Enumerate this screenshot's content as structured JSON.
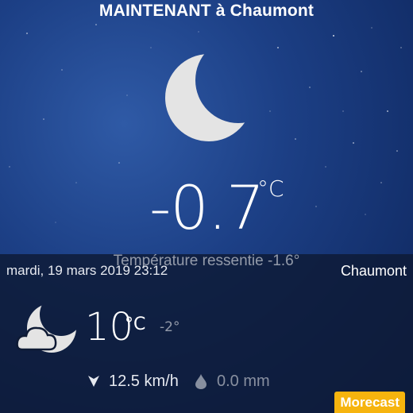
{
  "header": {
    "title": "MAINTENANT à Chaumont"
  },
  "current": {
    "condition_icon": "moon-icon",
    "temperature": "-0.7",
    "unit": "°C",
    "feels_like": "Température ressentie -1.6°"
  },
  "forecast": {
    "date": "mardi, 19 mars 2019 23:12",
    "city": "Chaumont",
    "condition_icon": "moon-cloud-icon",
    "temperature": "10",
    "unit": "°C",
    "min_temperature": "-2°",
    "wind_icon": "wind-direction-icon",
    "wind": "12.5 km/h",
    "rain_icon": "raindrop-icon",
    "rain": "0.0 mm"
  },
  "brand": {
    "label": "Morecast",
    "color": "#f6b40e"
  },
  "colors": {
    "sky_top": "#2f5aa6",
    "sky_bottom": "#0f2558",
    "panel": "#0e1a34"
  }
}
